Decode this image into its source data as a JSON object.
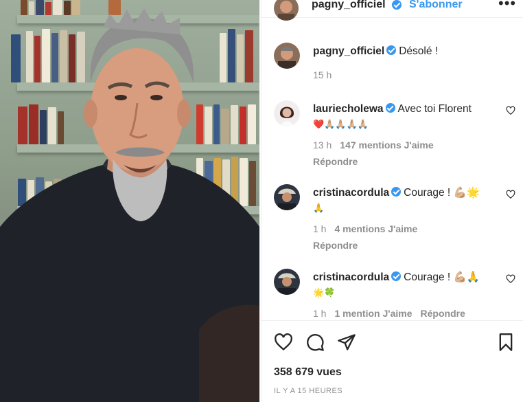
{
  "header": {
    "username": "pagny_officiel",
    "follow_label": "S'abonner",
    "more_label": "•••"
  },
  "comments": [
    {
      "username": "pagny_officiel",
      "text": "Désolé !",
      "time": "15 h",
      "likes": "",
      "reply": ""
    },
    {
      "username": "lauriecholewa",
      "text": "Avec toi Florent",
      "emoji": "❤️🙏🏼🙏🏼🙏🏼🙏🏼",
      "time": "13 h",
      "likes": "147 mentions J'aime",
      "reply": "Répondre"
    },
    {
      "username": "cristinacordula",
      "text": "Courage ! 💪🏼🌟",
      "emoji": "🙏",
      "time": "1 h",
      "likes": "4 mentions J'aime",
      "reply": "Répondre"
    },
    {
      "username": "cristinacordula",
      "text": "Courage ! 💪🏼🙏",
      "emoji": "🌟🍀",
      "time": "1 h",
      "likes": "1 mention J'aime",
      "reply": "Répondre"
    }
  ],
  "footer": {
    "views": "358 679 vues",
    "time_ago": "IL Y A 15 HEURES"
  },
  "icons": [
    "heart-icon",
    "comment-icon",
    "share-icon",
    "bookmark-icon",
    "more-icon",
    "verified-icon"
  ],
  "colors": {
    "verified": "#3897f0",
    "meta": "#8e8e8e",
    "text": "#262626"
  }
}
